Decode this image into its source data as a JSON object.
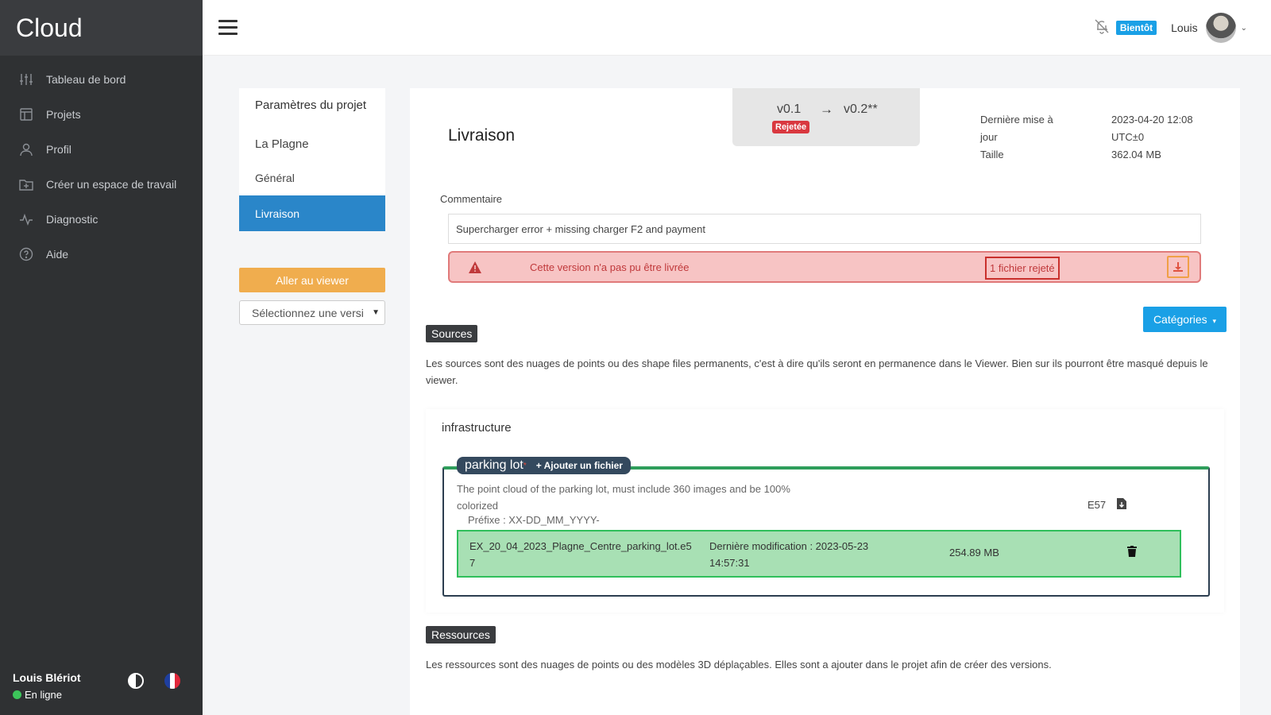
{
  "app": {
    "brand": "Cloud"
  },
  "sidebar": {
    "items": [
      {
        "label": "Tableau de bord",
        "icon": "sliders-icon"
      },
      {
        "label": "Projets",
        "icon": "layout-icon"
      },
      {
        "label": "Profil",
        "icon": "user-icon"
      },
      {
        "label": "Créer un espace de travail",
        "icon": "folder-plus-icon"
      },
      {
        "label": "Diagnostic",
        "icon": "activity-icon"
      },
      {
        "label": "Aide",
        "icon": "help-circle-icon"
      }
    ],
    "user": "Louis Blériot",
    "status": "En ligne",
    "status_color": "#3cc45a"
  },
  "topbar": {
    "soon_badge": "Bientôt",
    "user": "Louis"
  },
  "settings": {
    "title": "Paramètres du projet",
    "project": "La Plagne",
    "items": [
      "Général",
      "Livraison"
    ],
    "viewer_button": "Aller au viewer",
    "version_select": "Sélectionnez une versi"
  },
  "main": {
    "title": "Livraison",
    "version": {
      "from": "v0.1",
      "arrow": "→",
      "to": "v0.2**",
      "badge": "Rejetée"
    },
    "meta": {
      "updated_label": "Dernière mise à jour",
      "updated_value": "2023-04-20 12:08 UTC±0",
      "size_label": "Taille",
      "size_value": "362.04 MB"
    },
    "comment_label": "Commentaire",
    "comment_value": "Supercharger error + missing charger F2 and payment",
    "alert": {
      "message": "Cette version n'a pas pu être livrée",
      "files": "1 fichier rejeté"
    },
    "categories_button": "Catégories",
    "sources": {
      "tag": "Sources",
      "desc": "Les sources sont des nuages de points ou des shape files permanents, c'est à dire qu'ils seront en permanence dans le Viewer. Bien sur ils pourront être masqué depuis le viewer."
    },
    "category": {
      "title": "infrastructure",
      "layer": {
        "name": "parking lot",
        "required_mark": "*",
        "add_label": "+ Ajouter un fichier",
        "desc": "The point cloud of the parking lot, must include 360 images and be 100% colorized",
        "prefix": "Préfixe : XX-DD_MM_YYYY-",
        "ext": "E57",
        "file": {
          "name": "EX_20_04_2023_Plagne_Centre_parking_lot.e57",
          "modified": "Dernière modification : 2023-05-23 14:57:31",
          "size": "254.89 MB"
        }
      }
    },
    "resources": {
      "tag": "Ressources",
      "desc": "Les ressources sont des nuages de points ou des modèles 3D déplaçables. Elles sont a ajouter dans le projet afin de créer des versions."
    }
  }
}
